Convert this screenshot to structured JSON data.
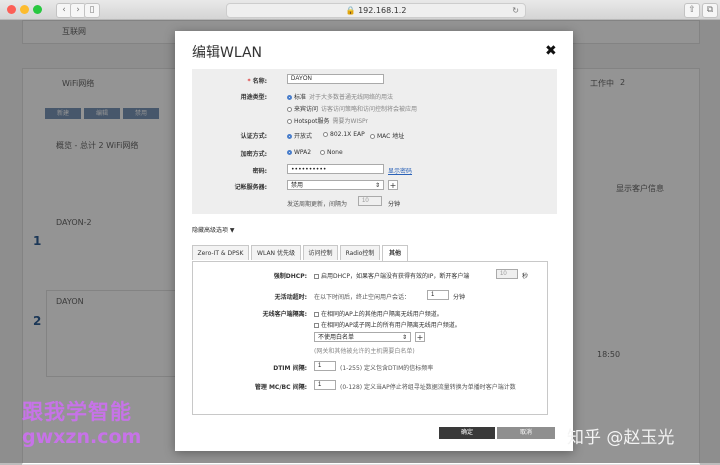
{
  "browser": {
    "address": "192.168.1.2"
  },
  "background": {
    "internet_title": "互联网",
    "wifi_title": "WiFi网络",
    "overview": "概览 - 总计 2 WiFi网络",
    "network1": "DAYON-2",
    "network2": "DAYON",
    "num1": "1",
    "num2": "2",
    "show_clients": "显示客户信息",
    "working_label": "工作中",
    "working_count": "2",
    "time_label": "18:50",
    "buttons": [
      "新建",
      "编辑",
      "禁用"
    ]
  },
  "modal": {
    "title": "编辑WLAN",
    "form": {
      "name_label": "名称:",
      "name_required": "*",
      "name_value": "DAYON",
      "usage_label": "用途类型:",
      "usage_options": [
        {
          "label": "标准",
          "hint": "对于大多数普通无线网络的用法",
          "selected": true
        },
        {
          "label": "来宾访问",
          "hint": "访客访问策略和访问控制将会被应用",
          "selected": false
        },
        {
          "label": "Hotspot服务",
          "hint": "需要为WISPr",
          "selected": false
        }
      ],
      "auth_label": "认证方式:",
      "auth_options": [
        {
          "label": "开放式",
          "selected": true
        },
        {
          "label": "802.1X EAP",
          "selected": false
        },
        {
          "label": "MAC 地址",
          "selected": false
        }
      ],
      "encrypt_label": "加密方式:",
      "encrypt_options": [
        {
          "label": "WPA2",
          "selected": true
        },
        {
          "label": "None",
          "selected": false
        }
      ],
      "password_label": "密码:",
      "password_value": "••••••••••",
      "show_password": "显示密码",
      "accounting_label": "记帐服务器:",
      "accounting_value": "禁用",
      "periodic_update": "发送周期更新，间隔为",
      "interval_value": "10",
      "interval_unit": "分钟"
    },
    "advanced_toggle": "隐藏高级选项 ▼",
    "tabs": [
      "Zero-IT & DPSK",
      "WLAN 优先级",
      "访问控制",
      "Radio控制",
      "其他"
    ],
    "other": {
      "dhcp_label": "强制DHCP:",
      "dhcp_text": "启用DHCP，如果客户端没有获得有效的IP，断开客户端",
      "dhcp_value": "10",
      "dhcp_unit": "秒",
      "idle_label": "无活动超时:",
      "idle_text": "在以下时间后，终止空闲用户会话：",
      "idle_value": "1",
      "idle_unit": "分钟",
      "isolation_label": "无线客户端隔离:",
      "isolation_opt1": "在相同的AP上的其他用户隔离无线用户频道。",
      "isolation_opt2": "在相同的AP或子网上的所有用户隔离无线用户频道。",
      "whitelist_value": "不使用白名单",
      "whitelist_hint": "(网关和其他被允许的主机需要白名单)",
      "dtim_label": "DTIM 间隔:",
      "dtim_value": "1",
      "dtim_text": "(1-255) 定义包含DTIM的信标频率",
      "mcbc_label": "管理 MC/BC 间隔:",
      "mcbc_value": "1",
      "mcbc_text": "(0-128) 定义当AP停止将组寻址数据流量转换为单播时客户端计数"
    },
    "ok_label": "确定",
    "cancel_label": "取消"
  },
  "watermarks": {
    "line1": "跟我学智能",
    "line2": "gwxzn.com",
    "zhihu": "知乎 @赵玉光"
  }
}
